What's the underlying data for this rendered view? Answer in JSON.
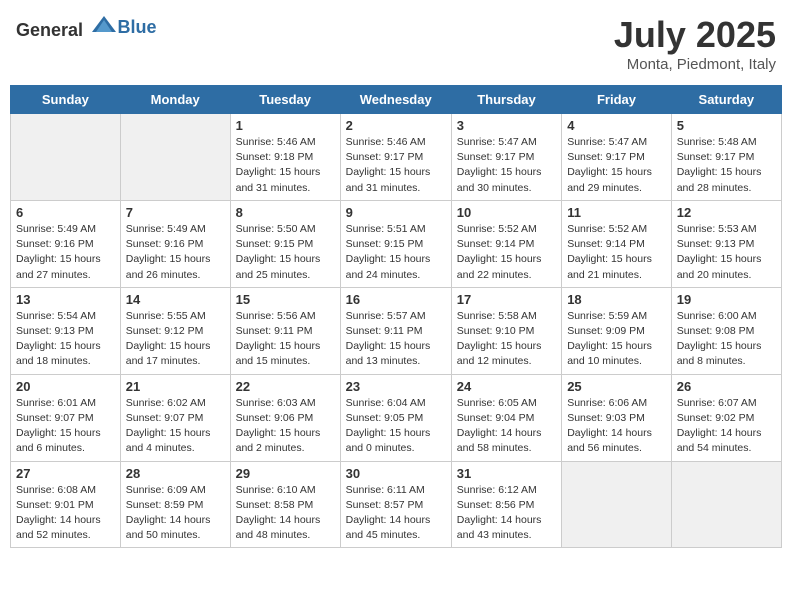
{
  "header": {
    "logo_general": "General",
    "logo_blue": "Blue",
    "title": "July 2025",
    "subtitle": "Monta, Piedmont, Italy"
  },
  "days_of_week": [
    "Sunday",
    "Monday",
    "Tuesday",
    "Wednesday",
    "Thursday",
    "Friday",
    "Saturday"
  ],
  "weeks": [
    [
      {
        "day": "",
        "sunrise": "",
        "sunset": "",
        "daylight": ""
      },
      {
        "day": "",
        "sunrise": "",
        "sunset": "",
        "daylight": ""
      },
      {
        "day": "1",
        "sunrise": "Sunrise: 5:46 AM",
        "sunset": "Sunset: 9:18 PM",
        "daylight": "Daylight: 15 hours and 31 minutes."
      },
      {
        "day": "2",
        "sunrise": "Sunrise: 5:46 AM",
        "sunset": "Sunset: 9:17 PM",
        "daylight": "Daylight: 15 hours and 31 minutes."
      },
      {
        "day": "3",
        "sunrise": "Sunrise: 5:47 AM",
        "sunset": "Sunset: 9:17 PM",
        "daylight": "Daylight: 15 hours and 30 minutes."
      },
      {
        "day": "4",
        "sunrise": "Sunrise: 5:47 AM",
        "sunset": "Sunset: 9:17 PM",
        "daylight": "Daylight: 15 hours and 29 minutes."
      },
      {
        "day": "5",
        "sunrise": "Sunrise: 5:48 AM",
        "sunset": "Sunset: 9:17 PM",
        "daylight": "Daylight: 15 hours and 28 minutes."
      }
    ],
    [
      {
        "day": "6",
        "sunrise": "Sunrise: 5:49 AM",
        "sunset": "Sunset: 9:16 PM",
        "daylight": "Daylight: 15 hours and 27 minutes."
      },
      {
        "day": "7",
        "sunrise": "Sunrise: 5:49 AM",
        "sunset": "Sunset: 9:16 PM",
        "daylight": "Daylight: 15 hours and 26 minutes."
      },
      {
        "day": "8",
        "sunrise": "Sunrise: 5:50 AM",
        "sunset": "Sunset: 9:15 PM",
        "daylight": "Daylight: 15 hours and 25 minutes."
      },
      {
        "day": "9",
        "sunrise": "Sunrise: 5:51 AM",
        "sunset": "Sunset: 9:15 PM",
        "daylight": "Daylight: 15 hours and 24 minutes."
      },
      {
        "day": "10",
        "sunrise": "Sunrise: 5:52 AM",
        "sunset": "Sunset: 9:14 PM",
        "daylight": "Daylight: 15 hours and 22 minutes."
      },
      {
        "day": "11",
        "sunrise": "Sunrise: 5:52 AM",
        "sunset": "Sunset: 9:14 PM",
        "daylight": "Daylight: 15 hours and 21 minutes."
      },
      {
        "day": "12",
        "sunrise": "Sunrise: 5:53 AM",
        "sunset": "Sunset: 9:13 PM",
        "daylight": "Daylight: 15 hours and 20 minutes."
      }
    ],
    [
      {
        "day": "13",
        "sunrise": "Sunrise: 5:54 AM",
        "sunset": "Sunset: 9:13 PM",
        "daylight": "Daylight: 15 hours and 18 minutes."
      },
      {
        "day": "14",
        "sunrise": "Sunrise: 5:55 AM",
        "sunset": "Sunset: 9:12 PM",
        "daylight": "Daylight: 15 hours and 17 minutes."
      },
      {
        "day": "15",
        "sunrise": "Sunrise: 5:56 AM",
        "sunset": "Sunset: 9:11 PM",
        "daylight": "Daylight: 15 hours and 15 minutes."
      },
      {
        "day": "16",
        "sunrise": "Sunrise: 5:57 AM",
        "sunset": "Sunset: 9:11 PM",
        "daylight": "Daylight: 15 hours and 13 minutes."
      },
      {
        "day": "17",
        "sunrise": "Sunrise: 5:58 AM",
        "sunset": "Sunset: 9:10 PM",
        "daylight": "Daylight: 15 hours and 12 minutes."
      },
      {
        "day": "18",
        "sunrise": "Sunrise: 5:59 AM",
        "sunset": "Sunset: 9:09 PM",
        "daylight": "Daylight: 15 hours and 10 minutes."
      },
      {
        "day": "19",
        "sunrise": "Sunrise: 6:00 AM",
        "sunset": "Sunset: 9:08 PM",
        "daylight": "Daylight: 15 hours and 8 minutes."
      }
    ],
    [
      {
        "day": "20",
        "sunrise": "Sunrise: 6:01 AM",
        "sunset": "Sunset: 9:07 PM",
        "daylight": "Daylight: 15 hours and 6 minutes."
      },
      {
        "day": "21",
        "sunrise": "Sunrise: 6:02 AM",
        "sunset": "Sunset: 9:07 PM",
        "daylight": "Daylight: 15 hours and 4 minutes."
      },
      {
        "day": "22",
        "sunrise": "Sunrise: 6:03 AM",
        "sunset": "Sunset: 9:06 PM",
        "daylight": "Daylight: 15 hours and 2 minutes."
      },
      {
        "day": "23",
        "sunrise": "Sunrise: 6:04 AM",
        "sunset": "Sunset: 9:05 PM",
        "daylight": "Daylight: 15 hours and 0 minutes."
      },
      {
        "day": "24",
        "sunrise": "Sunrise: 6:05 AM",
        "sunset": "Sunset: 9:04 PM",
        "daylight": "Daylight: 14 hours and 58 minutes."
      },
      {
        "day": "25",
        "sunrise": "Sunrise: 6:06 AM",
        "sunset": "Sunset: 9:03 PM",
        "daylight": "Daylight: 14 hours and 56 minutes."
      },
      {
        "day": "26",
        "sunrise": "Sunrise: 6:07 AM",
        "sunset": "Sunset: 9:02 PM",
        "daylight": "Daylight: 14 hours and 54 minutes."
      }
    ],
    [
      {
        "day": "27",
        "sunrise": "Sunrise: 6:08 AM",
        "sunset": "Sunset: 9:01 PM",
        "daylight": "Daylight: 14 hours and 52 minutes."
      },
      {
        "day": "28",
        "sunrise": "Sunrise: 6:09 AM",
        "sunset": "Sunset: 8:59 PM",
        "daylight": "Daylight: 14 hours and 50 minutes."
      },
      {
        "day": "29",
        "sunrise": "Sunrise: 6:10 AM",
        "sunset": "Sunset: 8:58 PM",
        "daylight": "Daylight: 14 hours and 48 minutes."
      },
      {
        "day": "30",
        "sunrise": "Sunrise: 6:11 AM",
        "sunset": "Sunset: 8:57 PM",
        "daylight": "Daylight: 14 hours and 45 minutes."
      },
      {
        "day": "31",
        "sunrise": "Sunrise: 6:12 AM",
        "sunset": "Sunset: 8:56 PM",
        "daylight": "Daylight: 14 hours and 43 minutes."
      },
      {
        "day": "",
        "sunrise": "",
        "sunset": "",
        "daylight": ""
      },
      {
        "day": "",
        "sunrise": "",
        "sunset": "",
        "daylight": ""
      }
    ]
  ]
}
